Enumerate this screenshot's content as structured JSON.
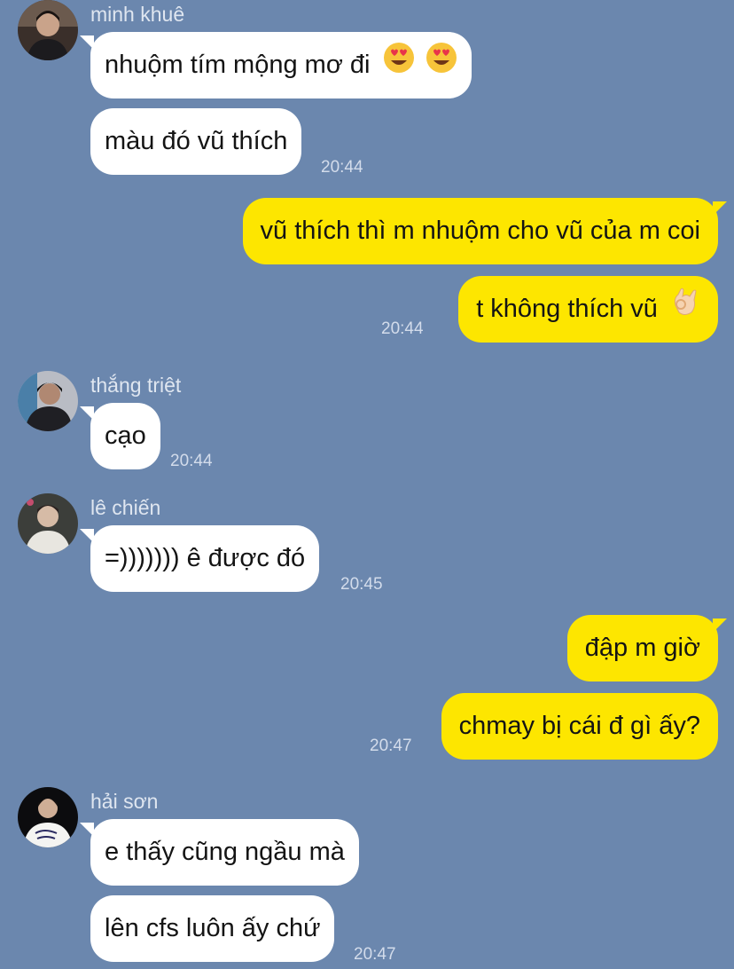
{
  "chat": {
    "groups": [
      {
        "sender": "minh khuê",
        "avatar_icon": "person-avatar",
        "messages": [
          "nhuộm tím mộng mơ đi",
          "màu đó vũ thích"
        ],
        "time": "20:44"
      },
      {
        "direction": "outgoing",
        "messages": [
          "vũ thích thì m nhuộm cho vũ của m coi",
          "t không thích vũ"
        ],
        "time": "20:44"
      },
      {
        "sender": "thắng triệt",
        "avatar_icon": "person-avatar",
        "messages": [
          "cạo"
        ],
        "time": "20:44"
      },
      {
        "sender": "lê chiến",
        "avatar_icon": "person-avatar",
        "messages": [
          "=))))))) ê được đó"
        ],
        "time": "20:45"
      },
      {
        "direction": "outgoing",
        "messages": [
          "đập m giờ",
          "chmay bị cái đ gì ấy?"
        ],
        "time": "20:47"
      },
      {
        "sender": "hải sơn",
        "avatar_icon": "person-avatar",
        "messages": [
          "e thấy cũng ngầu mà",
          "lên cfs luôn ấy chứ"
        ],
        "time": "20:47"
      }
    ]
  },
  "emoji": {
    "heart_eyes": "heart-eyes-emoji-icon",
    "ok_hand": "ok-hand-emoji-icon"
  },
  "colors": {
    "background": "#6b87ae",
    "incoming_bubble": "#ffffff",
    "outgoing_bubble": "#fde600",
    "text": "#141414",
    "sender_name": "#dfe6f0",
    "timestamp": "#d3dceb"
  }
}
